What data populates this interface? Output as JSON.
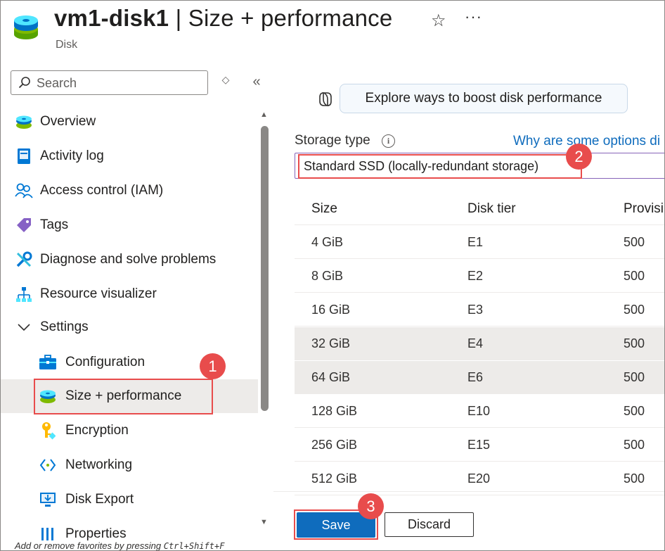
{
  "header": {
    "resource_name": "vm1-disk1",
    "separator": "|",
    "page_name": "Size + performance",
    "resource_type": "Disk",
    "favorite_icon": "star-icon",
    "more_icon": "ellipsis-icon",
    "more_label": "···"
  },
  "sidebar": {
    "search_placeholder": "Search",
    "sort_label": "◇",
    "collapse_label": "«",
    "items": [
      {
        "label": "Overview",
        "icon": "disk-icon"
      },
      {
        "label": "Activity log",
        "icon": "activity-log-icon"
      },
      {
        "label": "Access control (IAM)",
        "icon": "people-icon"
      },
      {
        "label": "Tags",
        "icon": "tag-icon"
      },
      {
        "label": "Diagnose and solve problems",
        "icon": "wrench-icon"
      },
      {
        "label": "Resource visualizer",
        "icon": "hierarchy-icon"
      },
      {
        "label": "Settings",
        "icon": "chevron-down-icon"
      },
      {
        "label": "Configuration",
        "icon": "toolbox-icon"
      },
      {
        "label": "Size + performance",
        "icon": "disk-icon"
      },
      {
        "label": "Encryption",
        "icon": "key-icon"
      },
      {
        "label": "Networking",
        "icon": "network-icon"
      },
      {
        "label": "Disk Export",
        "icon": "monitor-export-icon"
      },
      {
        "label": "Properties",
        "icon": "properties-icon"
      }
    ],
    "favorites_hint_prefix": "Add or remove favorites by pressing ",
    "favorites_hint_keys": "Ctrl+Shift+F"
  },
  "main": {
    "explore_button": "Explore ways to boost disk performance",
    "storage_type_label": "Storage type",
    "why_link": "Why are some options di",
    "storage_type_value": "Standard SSD (locally-redundant storage)",
    "table": {
      "headers": [
        "Size",
        "Disk tier",
        "Provisi"
      ],
      "rows": [
        [
          "4 GiB",
          "E1",
          "500"
        ],
        [
          "8 GiB",
          "E2",
          "500"
        ],
        [
          "16 GiB",
          "E3",
          "500"
        ],
        [
          "32 GiB",
          "E4",
          "500"
        ],
        [
          "64 GiB",
          "E6",
          "500"
        ],
        [
          "128 GiB",
          "E10",
          "500"
        ],
        [
          "256 GiB",
          "E15",
          "500"
        ],
        [
          "512 GiB",
          "E20",
          "500"
        ]
      ]
    },
    "save_label": "Save",
    "discard_label": "Discard"
  },
  "annotations": {
    "step1": "1",
    "step2": "2",
    "step3": "3",
    "color": "#e84c4c"
  },
  "colors": {
    "accent": "#0f6cbd",
    "selected_row": "#edebe9",
    "annotation": "#e84c4c"
  }
}
